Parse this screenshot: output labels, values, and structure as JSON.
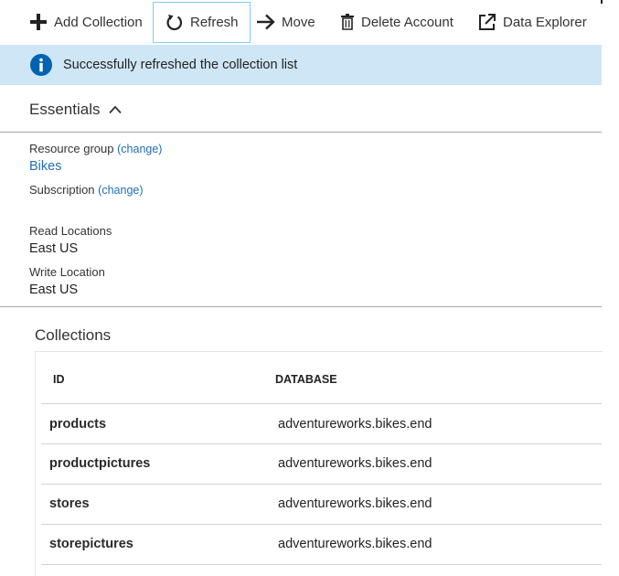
{
  "toolbar": {
    "add_collection": "Add Collection",
    "refresh": "Refresh",
    "move": "Move",
    "delete_account": "Delete Account",
    "data_explorer": "Data Explorer"
  },
  "notification": {
    "message": "Successfully refreshed the collection list"
  },
  "essentials": {
    "title": "Essentials",
    "resource_group_label": "Resource group",
    "change_label": "(change)",
    "resource_group_value": "Bikes",
    "subscription_label": "Subscription",
    "read_locations_label": "Read Locations",
    "read_locations_value": "East US",
    "write_location_label": "Write Location",
    "write_location_value": "East US"
  },
  "collections": {
    "title": "Collections",
    "columns": [
      "ID",
      "DATABASE"
    ],
    "rows": [
      {
        "id": "products",
        "database": "adventureworks.bikes.end"
      },
      {
        "id": "productpictures",
        "database": "adventureworks.bikes.end"
      },
      {
        "id": "stores",
        "database": "adventureworks.bikes.end"
      },
      {
        "id": "storepictures",
        "database": "adventureworks.bikes.end"
      }
    ]
  },
  "colors": {
    "info_bar": "#cfe6f6",
    "info_icon": "#0063b1",
    "link": "#1f6fb5",
    "focus_border": "#7fcff2"
  }
}
